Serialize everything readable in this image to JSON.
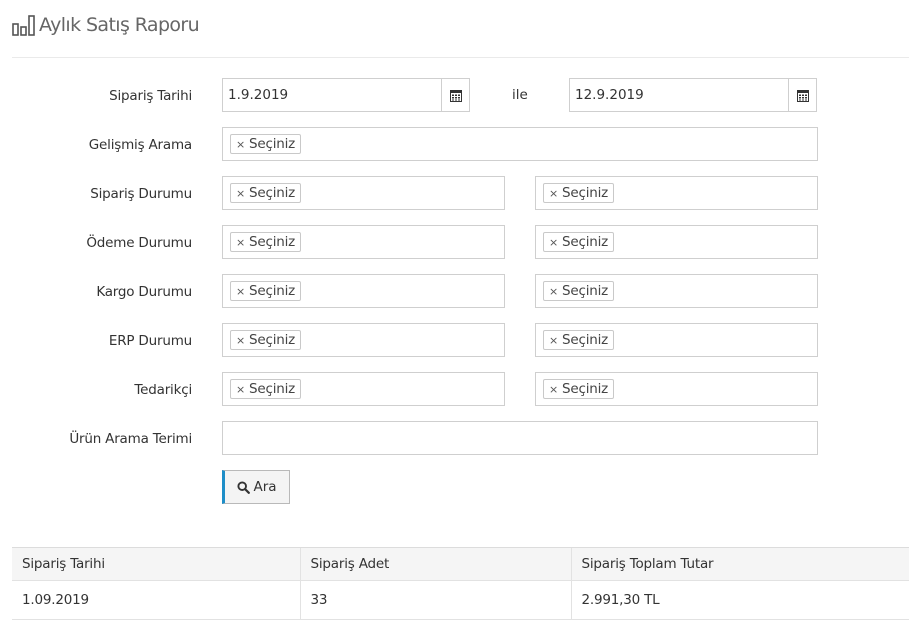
{
  "page": {
    "title": "Aylık Satış Raporu",
    "icon": "bar-chart-icon"
  },
  "filters": {
    "order_date": {
      "label": "Sipariş Tarihi",
      "start": "1.9.2019",
      "separator": "ile",
      "end": "12.9.2019",
      "icon": "calendar-icon"
    },
    "advanced_search": {
      "label": "Gelişmiş Arama",
      "tag": "Seçiniz",
      "remove_glyph": "×"
    },
    "order_status": {
      "label": "Sipariş Durumu",
      "left_tag": "Seçiniz",
      "right_tag": "Seçiniz"
    },
    "payment_status": {
      "label": "Ödeme Durumu",
      "left_tag": "Seçiniz",
      "right_tag": "Seçiniz"
    },
    "shipping_status": {
      "label": "Kargo Durumu",
      "left_tag": "Seçiniz",
      "right_tag": "Seçiniz"
    },
    "erp_status": {
      "label": "ERP Durumu",
      "left_tag": "Seçiniz",
      "right_tag": "Seçiniz"
    },
    "supplier": {
      "label": "Tedarikçi",
      "left_tag": "Seçiniz",
      "right_tag": "Seçiniz"
    },
    "product_search": {
      "label": "Ürün Arama Terimi",
      "value": ""
    },
    "search_button": {
      "label": "Ara",
      "icon": "search-icon",
      "accent": "#1e8ec8"
    }
  },
  "table": {
    "columns": [
      "Sipariş Tarihi",
      "Sipariş Adet",
      "Sipariş Toplam Tutar"
    ],
    "rows": [
      [
        "1.09.2019",
        "33",
        "2.991,30 TL"
      ]
    ]
  }
}
